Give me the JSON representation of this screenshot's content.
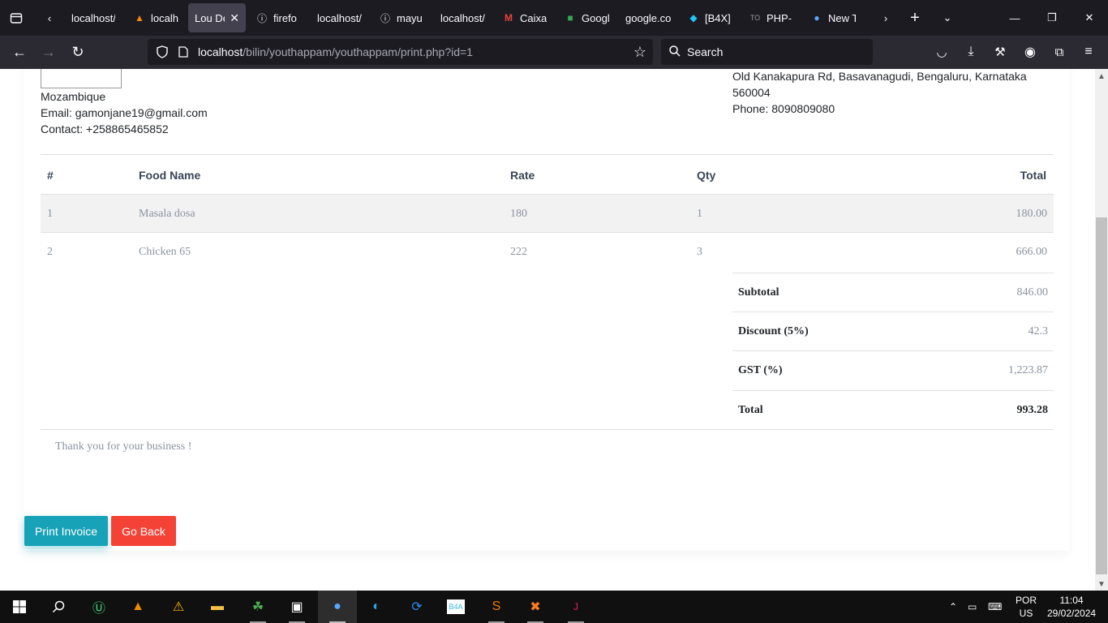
{
  "browser": {
    "tabs": [
      {
        "label": "localhost/",
        "icon": "page-icon"
      },
      {
        "label": "localh",
        "icon": "vlc-icon"
      },
      {
        "label": "Lou Del",
        "icon": "none",
        "active": true
      },
      {
        "label": "firefo",
        "icon": "info-icon"
      },
      {
        "label": "localhost/",
        "icon": "page-icon"
      },
      {
        "label": "mayu",
        "icon": "info-icon"
      },
      {
        "label": "localhost/",
        "icon": "page-icon"
      },
      {
        "label": "Caixa",
        "icon": "gmail-icon"
      },
      {
        "label": "Googl",
        "icon": "meet-icon"
      },
      {
        "label": "google.co",
        "icon": "page-icon"
      },
      {
        "label": "[B4X]",
        "icon": "b4x-icon"
      },
      {
        "label": "PHP-",
        "icon": "php-icon"
      },
      {
        "label": "New T",
        "icon": "firefox-icon"
      }
    ],
    "url_host": "localhost",
    "url_path": "/bilin/youthappam/youthappam/print.php?id=1",
    "search_placeholder": "Search"
  },
  "invoice": {
    "customer": {
      "country": "Mozambique",
      "email": "Email: gamonjane19@gmail.com",
      "contact": "Contact: +258865465852"
    },
    "restaurant": {
      "address_line1": "Old Kanakapura Rd, Basavanagudi, Bengaluru, Karnataka",
      "address_line2": "560004",
      "phone": "Phone: 8090809080"
    },
    "columns": {
      "num": "#",
      "food": "Food Name",
      "rate": "Rate",
      "qty": "Qty",
      "total": "Total"
    },
    "items": [
      {
        "num": "1",
        "food": "Masala dosa",
        "rate": "180",
        "qty": "1",
        "total": "180.00"
      },
      {
        "num": "2",
        "food": "Chicken 65",
        "rate": "222",
        "qty": "3",
        "total": "666.00"
      }
    ],
    "summary": {
      "subtotal_label": "Subtotal",
      "subtotal": "846.00",
      "discount_label": "Discount (5%)",
      "discount": "42.3",
      "gst_label": "GST (%)",
      "gst": "1,223.87",
      "total_label": "Total",
      "total": "993.28"
    },
    "thanks": "Thank you for your business !"
  },
  "actions": {
    "print": "Print Invoice",
    "back": "Go Back"
  },
  "taskbar": {
    "lang_top": "POR",
    "lang_bottom": "US",
    "time": "11:04",
    "date": "29/02/2024"
  },
  "colors": {
    "print_button": "#17a2b8",
    "back_button": "#f44336"
  }
}
